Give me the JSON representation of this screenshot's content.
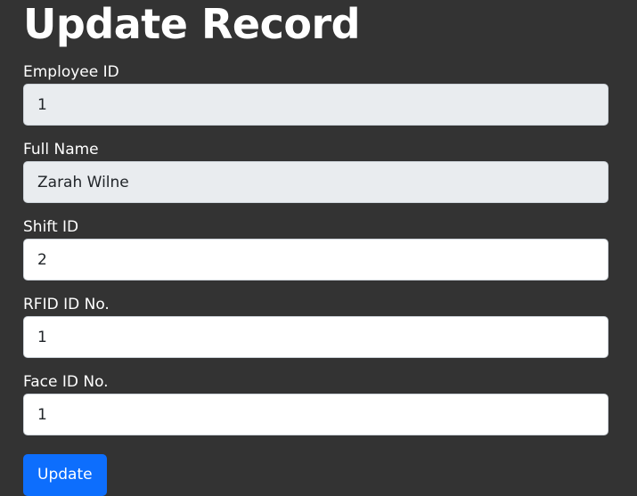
{
  "page": {
    "title": "Update Record"
  },
  "form": {
    "employee_id": {
      "label": "Employee ID",
      "value": "1"
    },
    "full_name": {
      "label": "Full Name",
      "value": "Zarah Wilne"
    },
    "shift_id": {
      "label": "Shift ID",
      "value": "2"
    },
    "rfid_id": {
      "label": "RFID ID No.",
      "value": "1"
    },
    "face_id": {
      "label": "Face ID No.",
      "value": "1"
    },
    "submit_label": "Update"
  },
  "colors": {
    "background": "#333333",
    "readonly_input": "#e9ecef",
    "primary_button": "#0d6efd"
  }
}
